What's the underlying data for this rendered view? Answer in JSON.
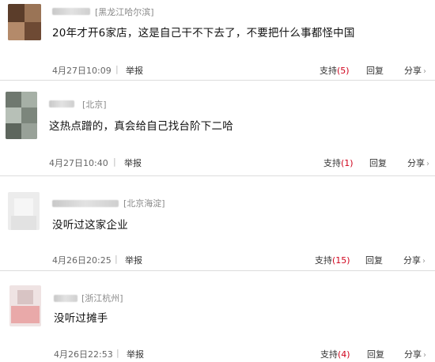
{
  "comments": [
    {
      "location": "[黑龙江哈尔滨]",
      "text": "20年才开6家店，这是自己干不下去了，不要把什么事都怪中国",
      "timestamp": "4月27日10:09",
      "report": "举报",
      "support_label": "支持",
      "support_count": "(5)",
      "reply": "回复",
      "share": "分享",
      "share_arrow": "›"
    },
    {
      "location": "[北京]",
      "text": "这热点蹭的，真会给自己找台阶下二哈",
      "timestamp": "4月27日10:40",
      "report": "举报",
      "support_label": "支持",
      "support_count": "(1)",
      "reply": "回复",
      "share": "分享",
      "share_arrow": "›"
    },
    {
      "location": "[北京海淀]",
      "text": "没听过这家企业",
      "timestamp": "4月26日20:25",
      "report": "举报",
      "support_label": "支持",
      "support_count": "(15)",
      "reply": "回复",
      "share": "分享",
      "share_arrow": "›"
    },
    {
      "location": "[浙江杭州]",
      "text": "没听过摊手",
      "timestamp": "4月26日22:53",
      "report": "举报",
      "support_label": "支持",
      "support_count": "(4)",
      "reply": "回复",
      "share": "分享",
      "share_arrow": "›"
    }
  ],
  "separator": "|",
  "colors": {
    "support_count": "#d0021b",
    "divider": "#dcdcdc"
  }
}
